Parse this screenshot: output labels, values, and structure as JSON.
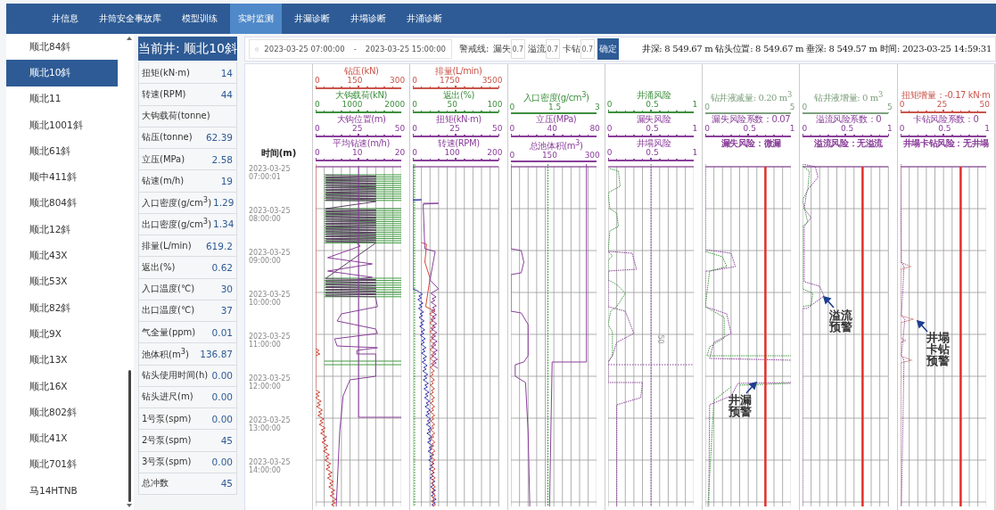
{
  "nav": [
    {
      "label": "井信息",
      "selected": false
    },
    {
      "label": "井筒安全事故库",
      "selected": false
    },
    {
      "label": "模型训练",
      "selected": false
    },
    {
      "label": "实时监测",
      "selected": true
    },
    {
      "label": "井漏诊断",
      "selected": false
    },
    {
      "label": "井塌诊断",
      "selected": false
    },
    {
      "label": "井涌诊断",
      "selected": false
    }
  ],
  "wells": [
    {
      "name": "顺北84斜",
      "selected": false
    },
    {
      "name": "顺北10斜",
      "selected": true
    },
    {
      "name": "顺北11",
      "selected": false
    },
    {
      "name": "顺北1001斜",
      "selected": false
    },
    {
      "name": "顺北61斜",
      "selected": false
    },
    {
      "name": "顺中411斜",
      "selected": false
    },
    {
      "name": "顺北804斜",
      "selected": false
    },
    {
      "name": "顺北12斜",
      "selected": false
    },
    {
      "name": "顺北43X",
      "selected": false
    },
    {
      "name": "顺北53X",
      "selected": false
    },
    {
      "name": "顺北82斜",
      "selected": false
    },
    {
      "name": "顺北9X",
      "selected": false
    },
    {
      "name": "顺北13X",
      "selected": false
    },
    {
      "name": "顺北16X",
      "selected": false
    },
    {
      "name": "顺北802斜",
      "selected": false
    },
    {
      "name": "顺北41X",
      "selected": false
    },
    {
      "name": "顺北701斜",
      "selected": false
    },
    {
      "name": "马14HTNB",
      "selected": false
    }
  ],
  "current_well": "当前井: 顺北10斜",
  "params": [
    {
      "label": "扭矩(kN·m)",
      "value": "14"
    },
    {
      "label": "转速(RPM)",
      "value": "44"
    },
    {
      "label": "大钩载荷(tonne)"
    },
    {
      "label": "钻压(tonne)",
      "value": "62.39"
    },
    {
      "label": "立压(MPa)",
      "value": "2.58"
    },
    {
      "label": "钻速(m/h)",
      "value": "19"
    },
    {
      "label": "入口密度(g/cm$^{3}$)",
      "value": "1.29"
    },
    {
      "label": "出口密度(g/cm$^{3}$)",
      "value": "1.34"
    },
    {
      "label": "排量(L/min)",
      "value": "619.2"
    },
    {
      "label": "返出(%)",
      "value": "0.62"
    },
    {
      "label": "入口温度(℃)",
      "value": "30"
    },
    {
      "label": "出口温度(℃)",
      "value": "37"
    },
    {
      "label": "气全量(ppm)",
      "value": "0.01"
    },
    {
      "label": "池体积(m$^{3}$)",
      "value": "136.87"
    },
    {
      "label": "钻头使用时间(h)",
      "value": "0.00"
    },
    {
      "label": "钻头进尺(m)",
      "value": "0.00"
    },
    {
      "label": "1号泵(spm)",
      "value": "0.00"
    },
    {
      "label": "2号泵(spm)",
      "value": "45"
    },
    {
      "label": "3号泵(spm)",
      "value": "0.00"
    },
    {
      "label": "总冲数",
      "value": "45"
    }
  ],
  "toolbar": {
    "start": "2023-03-25 07:00:00",
    "separator": "-",
    "end": "2023-03-25 15:00:00",
    "warning_label": "警戒线:",
    "warnings": [
      {
        "label": "漏失",
        "value": "0.7"
      },
      {
        "label": "溢流",
        "value": "0.7"
      },
      {
        "label": "卡钻",
        "value": "0.7"
      }
    ],
    "confirm": "确定",
    "status": "井深: 8 549.67 m 钻头位置: 8 549.67 m 垂深: 8 549.57 m 时间: 2023-03-25 14:59:31"
  },
  "time_column": {
    "heading": "时间(m)",
    "labels": [
      "2023-03-25 07:00:01",
      "2023-03-25 08:00:00",
      "2023-03-25 09:00:00",
      "2023-03-25 10:00:00",
      "2023-03-25 11:00:00",
      "2023-03-25 12:00:00",
      "2023-03-25 13:00:00",
      "2023-03-25 14:00:00"
    ]
  },
  "tracks": [
    {
      "kind": "log",
      "header": [
        {
          "kind": "scale",
          "title": "钻压(kN)",
          "min": "0",
          "mid": "150",
          "max": "300",
          "color": "#c8554b"
        },
        {
          "kind": "scale",
          "title": "大钩载荷(kN)",
          "min": "0",
          "mid": "1000",
          "max": "2000",
          "color": "#3f8f3f"
        },
        {
          "kind": "scale",
          "title": "大钩位置(m)",
          "min": "0",
          "mid": "25",
          "max": "50",
          "color": "#8a3f9a"
        },
        {
          "kind": "scale",
          "title": "平均钻速(m/h)",
          "min": "0",
          "mid": "10",
          "max": "20",
          "color": "#8a3f9a"
        }
      ]
    },
    {
      "kind": "log",
      "header": [
        {
          "kind": "scale",
          "title": "排量(L/min)",
          "min": "0",
          "mid": "1750",
          "max": "3500",
          "color": "#c8554b"
        },
        {
          "kind": "scale",
          "title": "返出(%)",
          "min": "0",
          "mid": "50",
          "max": "100",
          "color": "#3f8f3f"
        },
        {
          "kind": "scale",
          "title": "扭矩(kN·m)",
          "min": "0",
          "mid": "25",
          "max": "50",
          "color": "#8a3f9a"
        },
        {
          "kind": "scale",
          "title": "转速(RPM)",
          "min": "0",
          "mid": "100",
          "max": "200",
          "color": "#8a3f9a"
        }
      ]
    },
    {
      "kind": "log",
      "header": [
        {
          "kind": "scale",
          "title": "入口密度(g/cm$^{3}$)",
          "min": "0",
          "mid": "1.5",
          "max": "3",
          "color": "#3f8f3f"
        },
        {
          "kind": "scale",
          "title": "立压(MPa)",
          "min": "0",
          "mid": "40",
          "max": "80",
          "color": "#8a3f9a"
        },
        {
          "kind": "scale",
          "title": "总池体积(m$^{3}$)",
          "min": "0",
          "mid": "150",
          "max": "300",
          "color": "#8a3f9a"
        }
      ]
    },
    {
      "kind": "log",
      "note": "50",
      "header": [
        {
          "kind": "scale",
          "title": "井涌风险",
          "min": "0",
          "mid": "0.5",
          "max": "1",
          "color": "#3f8f3f"
        },
        {
          "kind": "scale",
          "title": "漏失风险",
          "min": "0",
          "mid": "0.5",
          "max": "1",
          "color": "#8a3f9a"
        },
        {
          "kind": "scale",
          "title": "井塌风险",
          "min": "0",
          "mid": "0.5",
          "max": "1",
          "color": "#8a3f9a"
        }
      ]
    },
    {
      "kind": "risk",
      "annotation": "井漏预警",
      "header": [
        {
          "kind": "reading",
          "title": "钻井液减量: 0.20 m$^{3}$",
          "min": "0",
          "max": "5",
          "color": "#7fa07f"
        },
        {
          "kind": "scale",
          "title": "漏失风险系数：0.07",
          "min": "0",
          "mid": "0.5",
          "max": "1",
          "color": "#8a3f9a"
        },
        {
          "kind": "text",
          "title": "漏失风险：微漏",
          "color": "#8a3f9a"
        }
      ]
    },
    {
      "kind": "risk",
      "annotation": "溢流预警",
      "header": [
        {
          "kind": "reading",
          "title": "钻井液增量: 0 m$^{3}$",
          "min": "0",
          "max": "5",
          "color": "#7fa07f"
        },
        {
          "kind": "scale",
          "title": "溢流风险系数：0",
          "min": "0",
          "mid": "0.5",
          "max": "1",
          "color": "#8a3f9a"
        },
        {
          "kind": "text",
          "title": "溢流风险：无溢流",
          "color": "#8a3f9a"
        }
      ]
    },
    {
      "kind": "risk",
      "annotation": "井塌卡钻预警",
      "header": [
        {
          "kind": "scale",
          "title": "扭矩增量：-0.17 kN·m",
          "min": "0",
          "mid": "25",
          "max": "50",
          "color": "#c8554b"
        },
        {
          "kind": "scale",
          "title": "卡钻风险系数：0",
          "min": "0",
          "mid": "0.5",
          "max": "1",
          "color": "#8a3f9a"
        },
        {
          "kind": "text",
          "title": "井塌卡钻风险：无井塌",
          "color": "#8a3f9a"
        }
      ]
    }
  ]
}
